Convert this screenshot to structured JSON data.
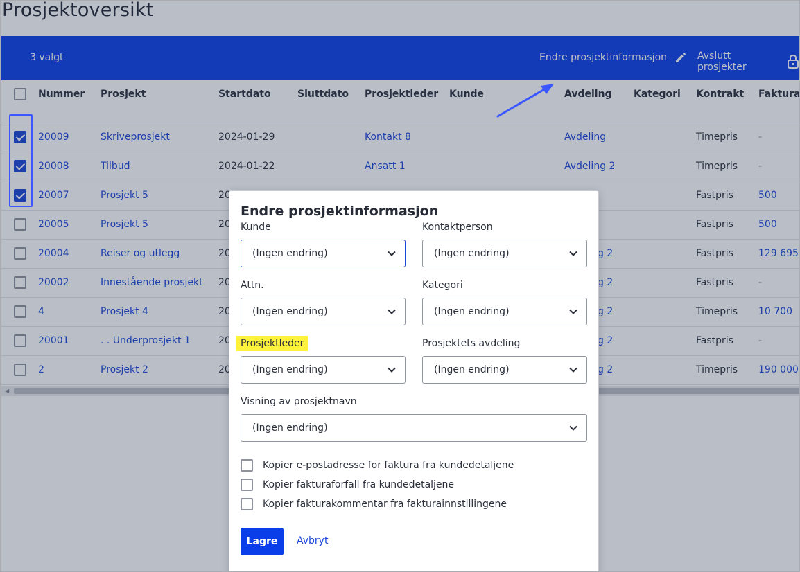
{
  "page": {
    "title": "Prosjektoversikt"
  },
  "toolbar": {
    "selected_count": "3 valgt",
    "edit_action": "Endre prosjektinformasjon",
    "close_action": "Avslutt prosjekter"
  },
  "table": {
    "columns": [
      "Nummer",
      "Prosjekt",
      "Startdato",
      "Sluttdato",
      "Prosjektleder",
      "Kunde",
      "Avdeling",
      "Kategori",
      "Kontrakt",
      "Fakturare"
    ],
    "rows": [
      {
        "checked": true,
        "nummer": "20009",
        "prosjekt": "Skriveprosjekt",
        "startdato": "2024-01-29",
        "prosjektleder": "Kontakt 8",
        "avdeling": "Avdeling",
        "kontrakt": "Timepris",
        "faktura": "-"
      },
      {
        "checked": true,
        "nummer": "20008",
        "prosjekt": "Tilbud",
        "startdato": "2024-01-22",
        "prosjektleder": "Ansatt 1",
        "avdeling": "Avdeling 2",
        "kontrakt": "Timepris",
        "faktura": "-"
      },
      {
        "checked": true,
        "nummer": "20007",
        "prosjekt": "Prosjekt 5",
        "startdato": "20",
        "prosjektleder": "",
        "avdeling": "",
        "kontrakt": "Fastpris",
        "faktura": "500"
      },
      {
        "checked": false,
        "nummer": "20005",
        "prosjekt": "Prosjekt 5",
        "startdato": "20",
        "prosjektleder": "",
        "avdeling": "",
        "kontrakt": "Fastpris",
        "faktura": "500"
      },
      {
        "checked": false,
        "nummer": "20004",
        "prosjekt": "Reiser og utlegg",
        "startdato": "20",
        "prosjektleder": "",
        "avdeling": "g 2",
        "kontrakt": "Fastpris",
        "faktura": "129 695"
      },
      {
        "checked": false,
        "nummer": "20002",
        "prosjekt": "Innestående prosjekt",
        "startdato": "20",
        "prosjektleder": "",
        "avdeling": "g 2",
        "kontrakt": "Fastpris",
        "faktura": "-"
      },
      {
        "checked": false,
        "nummer": "4",
        "prosjekt": "Prosjekt 4",
        "startdato": "20",
        "prosjektleder": "",
        "avdeling": "g 2",
        "kontrakt": "Timepris",
        "faktura": "10 700"
      },
      {
        "checked": false,
        "nummer": "20001",
        "prosjekt": ". . Underprosjekt 1",
        "startdato": "20",
        "prosjektleder": "",
        "avdeling": "g 2",
        "kontrakt": "Fastpris",
        "faktura": "-"
      },
      {
        "checked": false,
        "nummer": "2",
        "prosjekt": "Prosjekt 2",
        "startdato": "20",
        "prosjektleder": "",
        "avdeling": "g 2",
        "kontrakt": "Timepris",
        "faktura": "190 000"
      }
    ]
  },
  "modal": {
    "title": "Endre prosjektinformasjon",
    "fields": [
      {
        "label": "Kunde",
        "value": "(Ingen endring)"
      },
      {
        "label": "Kontaktperson",
        "value": "(Ingen endring)"
      },
      {
        "label": "Attn.",
        "value": "(Ingen endring)"
      },
      {
        "label": "Kategori",
        "value": "(Ingen endring)"
      },
      {
        "label": "Prosjektleder",
        "value": "(Ingen endring)"
      },
      {
        "label": "Prosjektets avdeling",
        "value": "(Ingen endring)"
      },
      {
        "label": "Visning av prosjektnavn",
        "value": "(Ingen endring)"
      }
    ],
    "checkboxes": [
      "Kopier e-postadresse for faktura fra kundedetaljene",
      "Kopier fakturaforfall fra kundedetaljene",
      "Kopier fakturakommentar fra fakturainnstillingene"
    ],
    "save_label": "Lagre",
    "cancel_label": "Avbryt"
  },
  "colors": {
    "accent": "#0a3ee8",
    "link": "#1945d8",
    "highlight": "#fff23a",
    "annotation": "#3b57ff"
  },
  "icons": [
    "pencil-icon",
    "lock-icon",
    "chevron-down-icon",
    "checkbox-icon"
  ]
}
